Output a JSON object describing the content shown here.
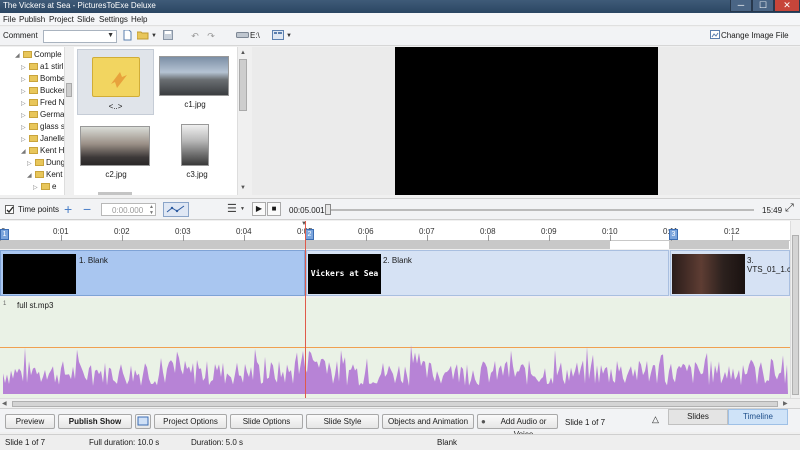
{
  "window": {
    "title": "The Vickers at Sea - PicturesToExe Deluxe",
    "min_glyph": "─",
    "max_glyph": "☐",
    "close_glyph": "✕"
  },
  "menu": [
    "File",
    "Publish",
    "Project",
    "Slide",
    "Settings",
    "Help"
  ],
  "toolbar": {
    "comment_label": "Comment",
    "comment_value": "",
    "drive_label": "E:\\",
    "change_image_label": "Change Image File"
  },
  "folder_tree": [
    {
      "label": "Comple",
      "expanded": true
    },
    {
      "label": "a1 stirl",
      "expanded": false
    },
    {
      "label": "Bombe",
      "expanded": false
    },
    {
      "label": "Bucker",
      "expanded": false
    },
    {
      "label": "Fred N",
      "expanded": false
    },
    {
      "label": "Germa",
      "expanded": false
    },
    {
      "label": "glass s",
      "expanded": false
    },
    {
      "label": "Janelle",
      "expanded": false
    },
    {
      "label": "Kent H",
      "expanded": true
    },
    {
      "label": "Dung",
      "expanded": false
    },
    {
      "label": "Kent",
      "expanded": true
    },
    {
      "label": "e",
      "expanded": false
    }
  ],
  "thumbnails": [
    {
      "label": "<..>",
      "kind": "folder-up"
    },
    {
      "label": "c1.jpg",
      "kind": "photo"
    },
    {
      "label": "c2.jpg",
      "kind": "photo"
    },
    {
      "label": "c3.jpg",
      "kind": "photo"
    }
  ],
  "timeline_bar": {
    "time_points_label": "Time points",
    "time_points_checked": true,
    "time_input": "0:00.000",
    "current_time": "00:05.001",
    "total_time": "15:49",
    "play_glyph": "▶",
    "stop_glyph": "■"
  },
  "ruler": {
    "labels": [
      "0",
      "0:01",
      "0:02",
      "0:03",
      "0:04",
      "0:05",
      "0:06",
      "0:07",
      "0:08",
      "0:09",
      "0:10",
      "0:11",
      "0:12"
    ],
    "markers": [
      "1",
      "2",
      "3"
    ]
  },
  "slides": [
    {
      "label": "1. Blank",
      "thumb_text": ""
    },
    {
      "label": "2. Blank",
      "thumb_text": "Vickers at Sea"
    },
    {
      "label": "3. VTS_01_1.c",
      "thumb_text": ""
    }
  ],
  "audio": {
    "label": "full st.mp3",
    "index": "1"
  },
  "bottom_buttons": {
    "preview": "Preview",
    "publish": "Publish Show",
    "project_options": "Project Options",
    "slide_options": "Slide Options",
    "slide_style": "Slide Style",
    "objects_animation": "Objects and Animation",
    "add_audio": "Add Audio or Voice",
    "slide_count": "Slide 1 of 7",
    "tab_slides": "Slides",
    "tab_timeline": "Timeline",
    "collapse_glyph": "△"
  },
  "status": {
    "slide": "Slide 1 of 7",
    "full_duration": "Full duration: 10.0 s",
    "duration": "Duration: 5.0 s",
    "blank": "Blank"
  },
  "colors": {
    "accent": "#3f5b78",
    "waveform": "#b783d6",
    "slide_track": "#d6e2f4",
    "selected_slide": "#a9c6f0",
    "playhead": "#e05a4a",
    "orange_line": "#f0a050"
  }
}
